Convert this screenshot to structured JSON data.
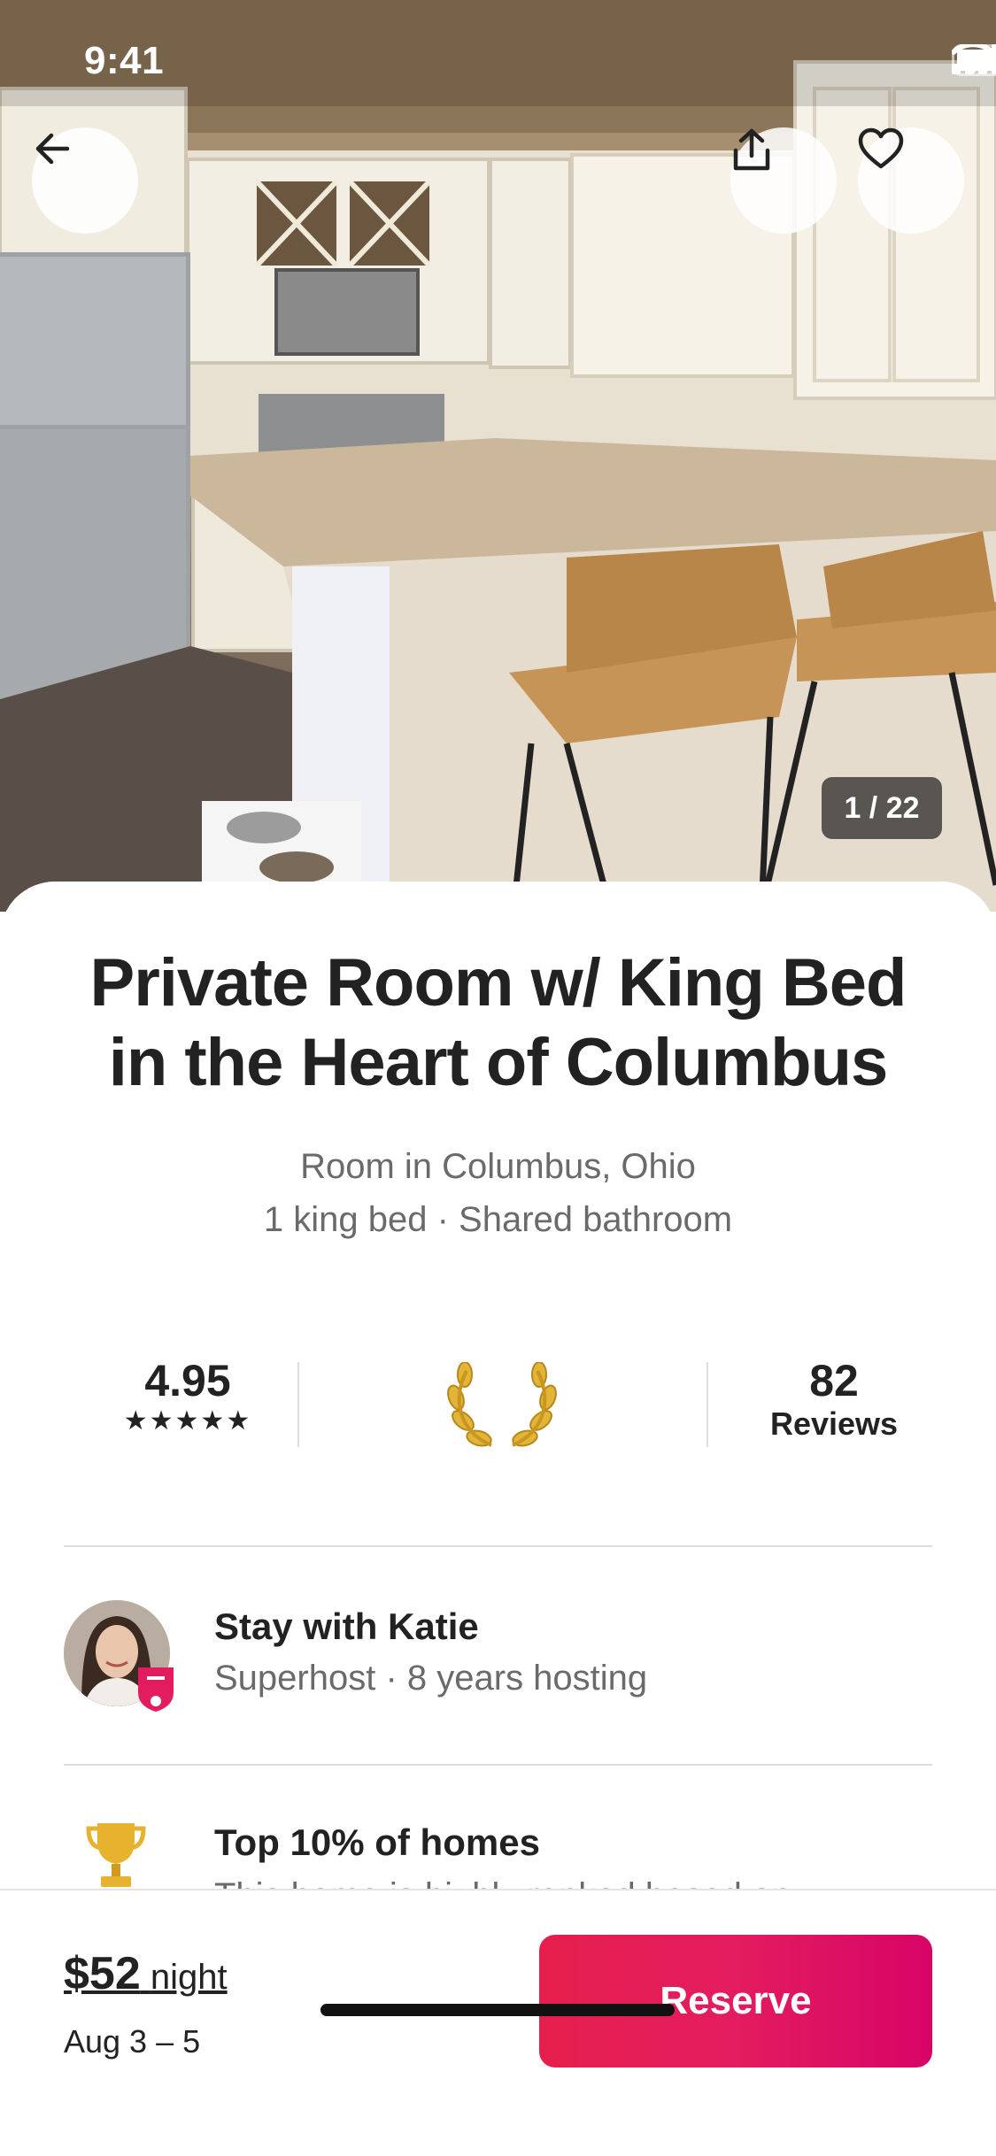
{
  "status_bar": {
    "time": "9:41"
  },
  "photo": {
    "counter": "1 / 22"
  },
  "listing": {
    "title": "Private Room w/ King Bed in the Heart of Columbus",
    "location": "Room in Columbus, Ohio",
    "details": "1 king bed · Shared bathroom"
  },
  "stats": {
    "rating": "4.95",
    "stars": "★★★★★",
    "reviews_count": "82",
    "reviews_label": "Reviews"
  },
  "host": {
    "title": "Stay with Katie",
    "subtitle": "Superhost · 8 years hosting"
  },
  "highlight": {
    "title": "Top 10% of homes",
    "description": "This home is highly ranked based on"
  },
  "footer": {
    "price_amount": "$52",
    "price_unit": "night",
    "dates": "Aug 3 – 5",
    "reserve_label": "Reserve"
  },
  "colors": {
    "accent": "#E31C5F",
    "text_primary": "#222222",
    "text_secondary": "#6A6A6A"
  },
  "icons": [
    "back-arrow-icon",
    "share-icon",
    "heart-icon",
    "laurel-left-icon",
    "laurel-right-icon",
    "trophy-icon",
    "superhost-badge-icon",
    "signal-icon",
    "wifi-icon",
    "battery-icon"
  ]
}
